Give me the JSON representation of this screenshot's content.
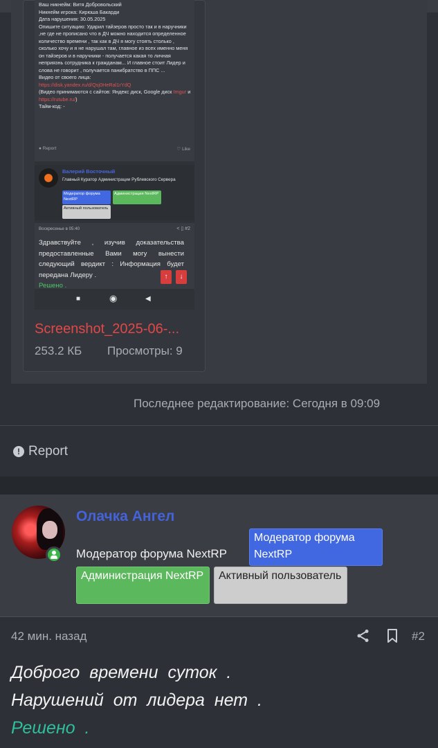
{
  "attachment": {
    "screenshot": {
      "report_text": [
        "Ваш никнейм: Витя Добровольский",
        "Никнейм игрока: Кирюша Бакарди",
        "Дата нарушения: 30.05.2025",
        "Опишите ситуацию: Ударил тайзеров просто так и в наручники ,не где не прописано что в ДЧ можно находится определенное количество времени , так как в ДЧ я могу стоять столько , сколько хочу и я не нарушал там, главное из всех именно меня он тайзеров и в наручники - получается какая то личная неприязнь сотрудника к гражданам... И главное стоит Лидер и слова не говорит , получается панибратство в ППС ...",
        "Видео от своего лица:"
      ],
      "video_link": "https://disk.yandex.ru/d/Qsj0HeRal1rYdQ",
      "sites_pre": "(Видео принимаются с сайтов: Яндекс диск, Google диск",
      "sites_imgur": "Imgur",
      "sites_and": "и",
      "sites_rutube": "https://rutube.ru/",
      "sites_post": ")",
      "timecode": "Тайм-код: -",
      "report_label": "Report",
      "like_label": "Like",
      "curator_name": "Валерий Восточный",
      "curator_role": "Главный Куратор Администрации Рублевского Сервера",
      "curator_badges": [
        "Модератор форума NextRP",
        "Администрация NextRP",
        "Активный пользователь"
      ],
      "reply_time": "Воскресенье в 05:40",
      "reply_num": "#2",
      "reply_text": "Здравствуйте , изучив доказательства предоставленные Вами могу вынести следующий вердикт : Информация будет передана Лидеру .",
      "reply_status": "Решено ."
    },
    "filename": "Screenshot_2025-06-...",
    "size": "253.2 КБ",
    "views": "Просмотры: 9"
  },
  "last_edit": "Последнее редактирование: Сегодня в 09:09",
  "report_label": "Report",
  "post": {
    "author": "Олачка Ангел",
    "role": "Модератор форума NextRP",
    "badges": {
      "moderator": "Модератор форума NextRP",
      "admin": "Администрация NextRP",
      "active": "Активный пользователь"
    },
    "time": "42 мин. назад",
    "number": "#2",
    "lines": [
      "Доброго времени суток .",
      "Нарушений от лидера нет ."
    ],
    "status": "Решено ."
  },
  "colors": {
    "background": "#2d3036",
    "username": "#4563d9",
    "resolved": "#2fbf9c",
    "badge_moderator": "#4168e0",
    "badge_admin": "#5cb85c",
    "badge_active": "#cdcdcd"
  }
}
